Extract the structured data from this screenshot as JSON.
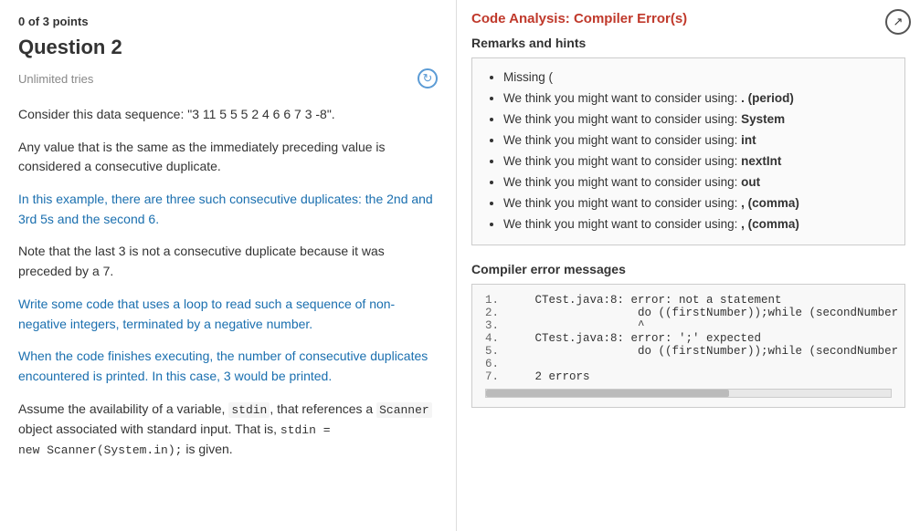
{
  "left": {
    "points_label": "0 of 3 points",
    "question_title": "Question 2",
    "unlimited_tries": "Unlimited tries",
    "paragraphs": [
      {
        "id": "p1",
        "parts": [
          {
            "text": "Consider this data sequence: \"3 11 5 5 5 2 4 6 6 7 3 -8\".",
            "type": "normal"
          }
        ]
      },
      {
        "id": "p2",
        "parts": [
          {
            "text": "Any value that is the same as the immediately preceding value is considered a consecutive duplicate.",
            "type": "normal"
          }
        ]
      },
      {
        "id": "p3",
        "parts": [
          {
            "text": "In this example, there are three such consecutive duplicates: the 2nd and 3rd 5s and the second 6.",
            "type": "highlight_blue"
          }
        ]
      },
      {
        "id": "p4",
        "parts": [
          {
            "text": "Note that the last 3 is not a consecutive duplicate because it was preceded by a 7.",
            "type": "normal"
          }
        ]
      },
      {
        "id": "p5",
        "parts": [
          {
            "text": "Write some code that uses a loop to read such a sequence of non-negative integers, terminated by a negative number.",
            "type": "highlight_blue"
          }
        ]
      },
      {
        "id": "p6",
        "parts": [
          {
            "text": "When the code finishes executing, the number of consecutive duplicates encountered is printed. In this case, 3  would be printed.",
            "type": "highlight_blue_partial"
          }
        ]
      },
      {
        "id": "p7",
        "parts": [
          {
            "text": "Assume the availability of a variable, stdin, that references a Scanner object associated with standard input. That is, stdin = new Scanner(System.in); is given.",
            "type": "code_inline"
          }
        ]
      }
    ]
  },
  "right": {
    "title": "Code Analysis: Compiler Error(s)",
    "expand_icon": "↗",
    "remarks_label": "Remarks and hints",
    "hints": [
      {
        "text": "Missing (",
        "bold_part": ""
      },
      {
        "text": "We think you might want to consider using: ",
        "bold_part": ". (period)"
      },
      {
        "text": "We think you might want to consider using: ",
        "bold_part": "System"
      },
      {
        "text": "We think you might want to consider using: ",
        "bold_part": "int"
      },
      {
        "text": "We think you might want to consider using: ",
        "bold_part": "nextInt"
      },
      {
        "text": "We think you might want to consider using: ",
        "bold_part": "out"
      },
      {
        "text": "We think you might want to consider using: ",
        "bold_part": ", (comma)"
      },
      {
        "text": "We think you might want to consider using: ",
        "bold_part": ", (comma)"
      }
    ],
    "compiler_label": "Compiler error messages",
    "compiler_lines": [
      {
        "num": "1.",
        "code": "   CTest.java:8: error: not a statement"
      },
      {
        "num": "2.",
        "code": "                  do ((firstNumber));while (secondNumber ="
      },
      {
        "num": "3.",
        "code": "                  ^"
      },
      {
        "num": "4.",
        "code": "   CTest.java:8: error: ';' expected"
      },
      {
        "num": "5.",
        "code": "                  do ((firstNumber));while (secondNumber ="
      },
      {
        "num": "6.",
        "code": ""
      },
      {
        "num": "7.",
        "code": "   2 errors"
      }
    ]
  }
}
